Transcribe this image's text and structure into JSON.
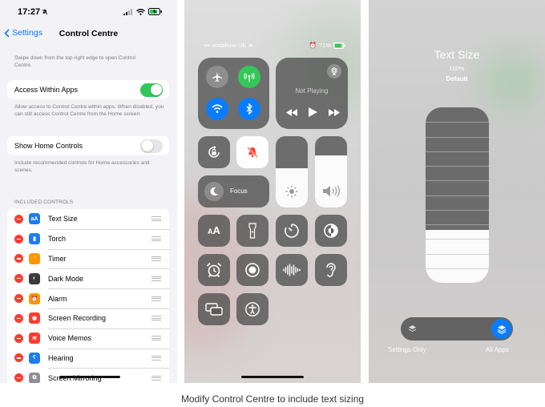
{
  "settings": {
    "status_time": "17:27",
    "back_label": "Settings",
    "title": "Control Centre",
    "intro_caption": "Swipe down from the top-right edge to open Control Centre.",
    "access_label": "Access Within Apps",
    "access_on": true,
    "access_caption": "Allow access to Control Centre within apps. When disabled, you can still access Control Centre from the Home screen.",
    "home_label": "Show Home Controls",
    "home_on": false,
    "home_caption": "Include recommended controls for Home accessories and scenes.",
    "section_header": "INCLUDED CONTROLS",
    "controls": [
      {
        "label": "Text Size",
        "icon": "text-size-icon",
        "color": "#1c7cf2"
      },
      {
        "label": "Torch",
        "icon": "torch-icon",
        "color": "#1c7cf2"
      },
      {
        "label": "Timer",
        "icon": "timer-icon",
        "color": "#ff9500"
      },
      {
        "label": "Dark Mode",
        "icon": "dark-mode-icon",
        "color": "#3a3a3c"
      },
      {
        "label": "Alarm",
        "icon": "alarm-icon",
        "color": "#ff9500"
      },
      {
        "label": "Screen Recording",
        "icon": "screen-recording-icon",
        "color": "#ff3b30"
      },
      {
        "label": "Voice Memos",
        "icon": "voice-memos-icon",
        "color": "#ff3b30"
      },
      {
        "label": "Hearing",
        "icon": "hearing-icon",
        "color": "#1c7cf2"
      },
      {
        "label": "Screen Mirroring",
        "icon": "screen-mirroring-icon",
        "color": "#8e8e93"
      }
    ]
  },
  "control_centre": {
    "carrier": "vodafone UK",
    "battery": "71%",
    "now_playing": "Not Playing",
    "focus_label": "Focus",
    "text_size_glyph": "AA",
    "colors": {
      "green": "#34c759",
      "blue": "#0a7cff",
      "orange": "#ff9500",
      "tile": "#505050"
    }
  },
  "text_size": {
    "title": "Text Size",
    "percent": "100%",
    "level": "Default",
    "scope_left": "Settings Only",
    "scope_right": "All Apps",
    "selected_scope": "All Apps"
  },
  "caption": "Modify Control Centre to include text sizing"
}
